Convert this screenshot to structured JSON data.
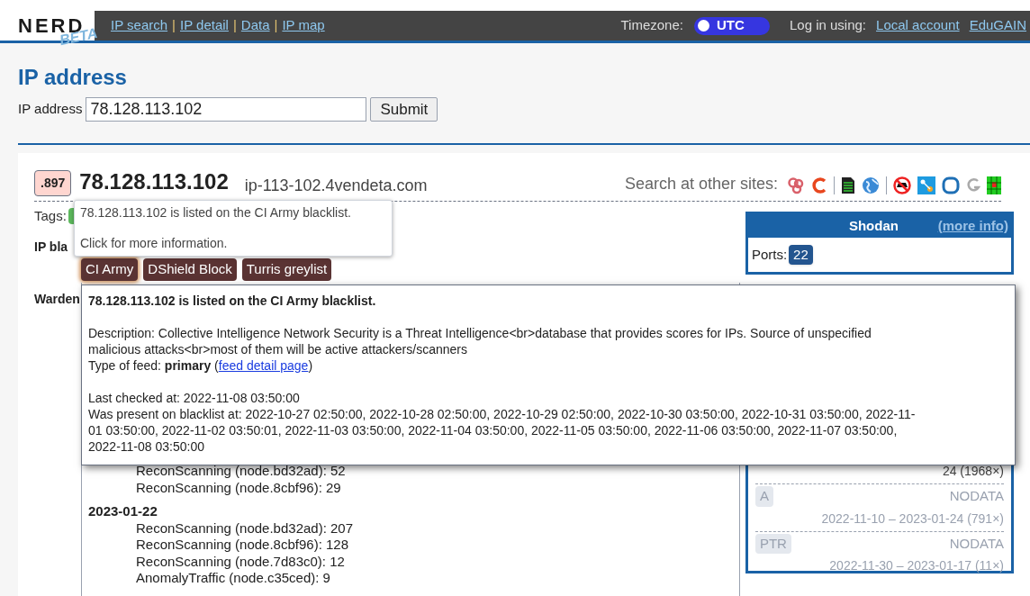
{
  "nav": {
    "logo": "NERD",
    "logo_badge": "BETA",
    "links": [
      "IP search",
      "IP detail",
      "Data",
      "IP map"
    ],
    "separators": [
      "|",
      "|",
      "|"
    ],
    "timezone_label": "Timezone:",
    "timezone": {
      "label": "UTC",
      "on": true
    },
    "login_label": "Log in using:",
    "login_links": [
      "Local account",
      "EduGAIN"
    ]
  },
  "form": {
    "heading": "IP address",
    "label": "IP address",
    "value": "78.128.113.102",
    "submit": "Submit"
  },
  "ip": {
    "score": ".897",
    "address": "78.128.113.102",
    "hostname": "ip-113-102.4vendeta.com"
  },
  "search_sites": {
    "label": "Search at other sites:"
  },
  "tags": {
    "label": "Tags:"
  },
  "blacklists": {
    "label": "IP bla",
    "items": [
      {
        "name": "CI Army",
        "selected": true
      },
      {
        "name": "DShield Block",
        "selected": false
      },
      {
        "name": "Turris greylist",
        "selected": false
      }
    ]
  },
  "warden": {
    "label": "Warden",
    "lines": [
      {
        "kind": "event",
        "text": "ReconScanning (node.bd32ad): 52"
      },
      {
        "kind": "event",
        "text": "ReconScanning (node.8cbf96): 29"
      },
      {
        "kind": "date",
        "text": "2023-01-22"
      },
      {
        "kind": "event",
        "text": "ReconScanning (node.bd32ad): 207"
      },
      {
        "kind": "event",
        "text": "ReconScanning (node.8cbf96): 128"
      },
      {
        "kind": "event",
        "text": "ReconScanning (node.7d83c0): 12"
      },
      {
        "kind": "event",
        "text": "AnomalyTraffic (node.c35ced): 9"
      }
    ]
  },
  "shodan": {
    "title": "Shodan",
    "more": "(more info)",
    "ports_label": "Ports:",
    "ports": [
      "22"
    ]
  },
  "dns": {
    "partial_range": "24 (1968×)",
    "records": [
      {
        "type": "A",
        "value": "NODATA",
        "range": "2022-11-10 – 2023-01-24 (791×)",
        "disabled": true
      },
      {
        "type": "PTR",
        "value": "NODATA",
        "range": "2022-11-30 – 2023-01-17 (11×)",
        "disabled": true
      }
    ]
  },
  "hover_tooltip": {
    "lines": [
      "78.128.113.102 is listed on the CI Army blacklist.",
      "Click for more information."
    ]
  },
  "detail_popup": {
    "title": "78.128.113.102 is listed on the CI Army blacklist.",
    "description": "Description: Collective Intelligence Network Security is a Threat Intelligence<br>database that provides scores for IPs. Source of unspecified malicious attacks<br>most of them will be active attackers/scanners",
    "feed_prefix": "Type of feed: **primary** (",
    "feed_link": "feed detail page",
    "feed_suffix": ")",
    "last_checked": "Last checked at: 2022-11-08 03:50:00",
    "present": "Was present on blacklist at: 2022-10-27 02:50:00, 2022-10-28 02:50:00, 2022-10-29 02:50:00, 2022-10-30 03:50:00, 2022-10-31 03:50:00, 2022-11-01 03:50:00, 2022-11-02 03:50:01, 2022-11-03 03:50:00, 2022-11-04 03:50:00, 2022-11-05 03:50:00, 2022-11-06 03:50:00, 2022-11-07 03:50:00, 2022-11-08 03:50:00"
  }
}
